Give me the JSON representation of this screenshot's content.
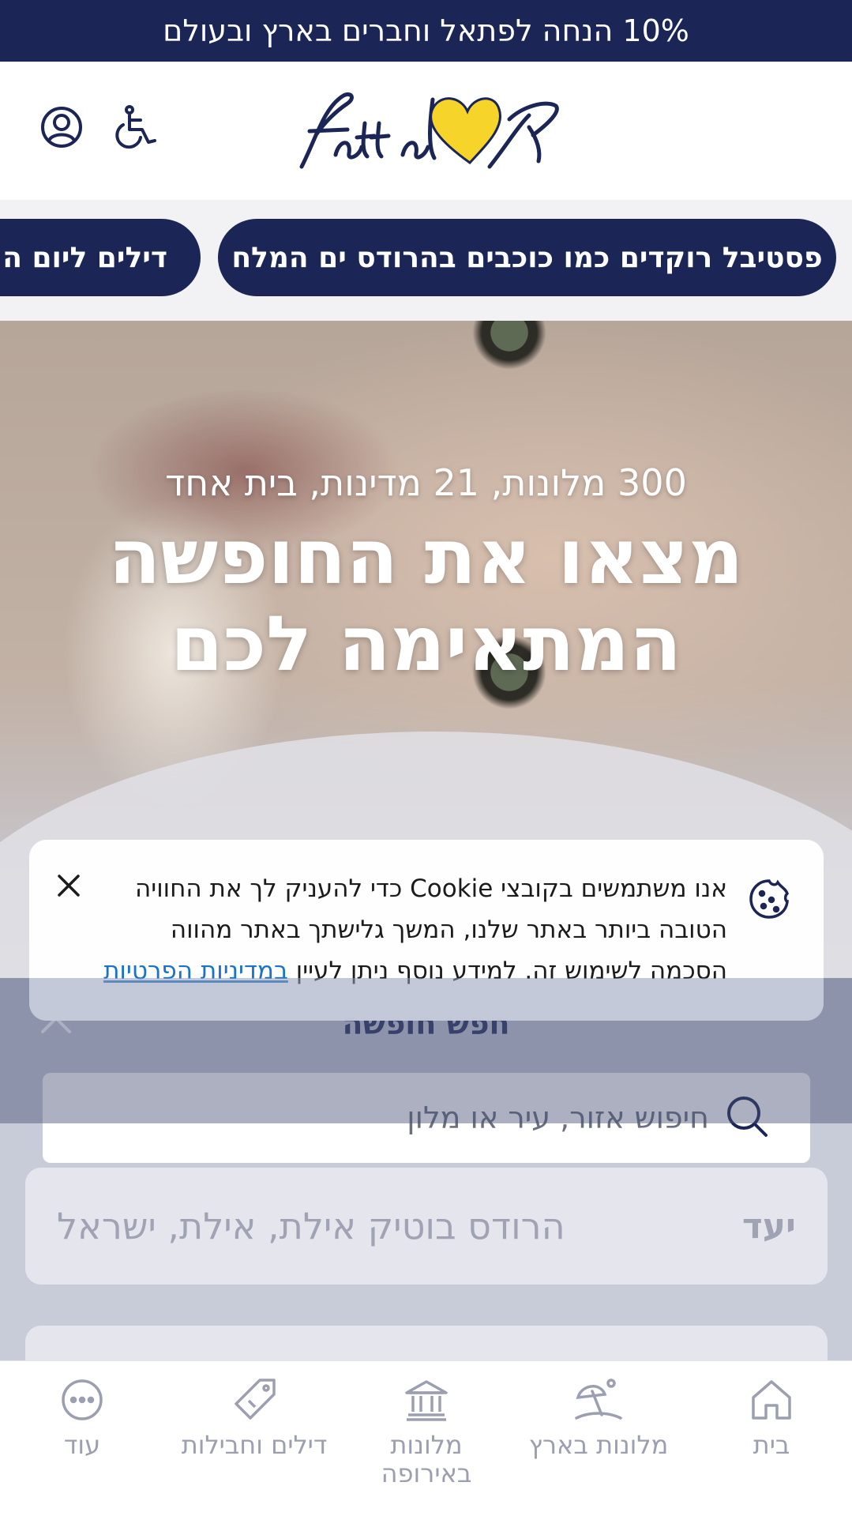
{
  "promo": {
    "text": "10% הנחה לפתאל וחברים בארץ ובעולם"
  },
  "header": {
    "logo_alt": "Fattal פתאל",
    "accessibility_icon": "wheelchair-icon",
    "account_icon": "user-circle-icon"
  },
  "chips": [
    {
      "label": "פסטיבל רוקדים כמו כוכבים בהרודס ים המלח"
    },
    {
      "label": "דילים ליום העצמאות"
    }
  ],
  "hero": {
    "subtitle": "300 מלונות, 21 מדינות, בית אחד",
    "title_line1": "מצאו את החופשה",
    "title_line2": "המתאימה לכם"
  },
  "cookie_banner": {
    "text": "אנו משתמשים בקובצי Cookie כדי להעניק לך את החוויה הטובה ביותר באתר שלנו, המשך גלישתך באתר מהווה הסכמה לשימוש זה. למידע נוסף ניתן לעיין ",
    "link_text": "במדיניות הפרטיות"
  },
  "search": {
    "title": "חפש חופשה",
    "placeholder": "חיפוש אזור, עיר או מלון",
    "destination_label": "יעד",
    "destination_value": "הרודס בוטיק אילת, אילת, ישראל"
  },
  "bottom_nav": [
    {
      "label": "בית",
      "icon": "home-icon"
    },
    {
      "label": "מלונות בארץ",
      "icon": "beach-umbrella-icon"
    },
    {
      "label": "מלונות באירופה",
      "icon": "landmark-icon"
    },
    {
      "label": "דילים וחבילות",
      "icon": "tag-icon"
    },
    {
      "label": "עוד",
      "icon": "more-icon"
    }
  ],
  "colors": {
    "brand_navy": "#1b2556",
    "brand_yellow": "#f6d42a",
    "link_blue": "#1a73c7"
  }
}
